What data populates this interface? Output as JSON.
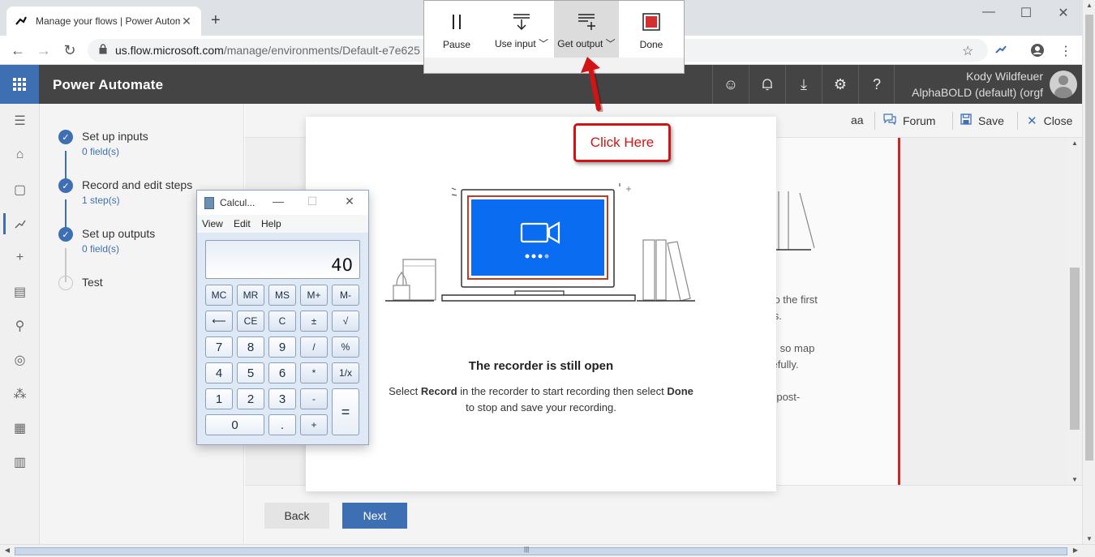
{
  "browser": {
    "tab_title": "Manage your flows | Power Autom",
    "new_tab": "+",
    "url_host": "us.flow.microsoft.com",
    "url_path": "/manage/environments/Default-e7e625"
  },
  "app": {
    "title": "Power Automate",
    "user_name": "Kody Wildfeuer",
    "user_org": "AlphaBOLD (default) (orgf"
  },
  "steps": {
    "items": [
      {
        "title": "Set up inputs",
        "sub": "0 field(s)",
        "done": true
      },
      {
        "title": "Record and edit steps",
        "sub": "1 step(s)",
        "done": true
      },
      {
        "title": "Set up outputs",
        "sub": "0 field(s)",
        "done": true
      },
      {
        "title": "Test",
        "sub": "",
        "done": false
      }
    ]
  },
  "toolbar": {
    "aa": "aa",
    "forum": "Forum",
    "save": "Save",
    "close": "Close"
  },
  "background_text": {
    "line1": "o to the first",
    "line2": "ess.",
    "line3": "op, so map",
    "line4": "arefully.",
    "line5": "ke post-"
  },
  "footer": {
    "back": "Back",
    "next": "Next"
  },
  "modal": {
    "title": "The recorder is still open",
    "desc_pre": "Select ",
    "desc_record": "Record",
    "desc_mid": " in the recorder to start recording then select ",
    "desc_done": "Done",
    "desc_post": "to stop and save your recording."
  },
  "recorder": {
    "buttons": [
      {
        "label": "Pause"
      },
      {
        "label": "Use input"
      },
      {
        "label": "Get output"
      },
      {
        "label": "Done"
      }
    ],
    "accent": "#d32f2f"
  },
  "calculator": {
    "title": "Calcul...",
    "menu": [
      "View",
      "Edit",
      "Help"
    ],
    "display": "40",
    "keys": {
      "mc": "MC",
      "mr": "MR",
      "ms": "MS",
      "mplus": "M+",
      "mminus": "M-",
      "back": "⟵",
      "ce": "CE",
      "c": "C",
      "plusminus": "±",
      "sqrt": "√",
      "k7": "7",
      "k8": "8",
      "k9": "9",
      "div": "/",
      "pct": "%",
      "k4": "4",
      "k5": "5",
      "k6": "6",
      "mul": "*",
      "recip": "1/x",
      "k1": "1",
      "k2": "2",
      "k3": "3",
      "minus": "-",
      "eq": "=",
      "k0": "0",
      "dot": ".",
      "plus": "+"
    }
  },
  "annotation": {
    "callout": "Click Here",
    "color": "#d21414"
  },
  "colors": {
    "brand": "#3f6fb3",
    "header": "#444444"
  }
}
